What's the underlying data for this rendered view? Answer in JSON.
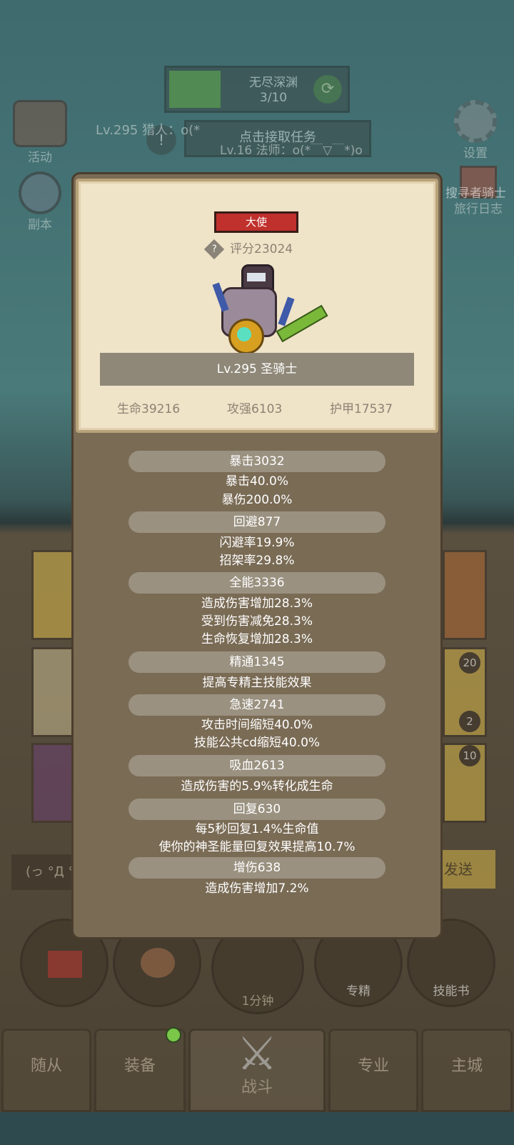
{
  "background": {
    "quest": {
      "title": "无尽深渊",
      "progress": "3/10",
      "accept_label": "点击接取任务"
    },
    "left_menu": [
      {
        "label": "活动"
      },
      {
        "label": "副本"
      }
    ],
    "right_menu": [
      {
        "label": "设置"
      },
      {
        "label": "旅行日志"
      }
    ],
    "party_line_1": "Lv.295 猎人：o(*",
    "party_line_2": "Lv.16 法师：o(*￣▽￣*)o",
    "chat_left": "(っ °Д °",
    "send_label": "发送",
    "timer": "1分钟",
    "round_buttons": [
      {
        "label": "专精"
      },
      {
        "label": "技能书"
      }
    ],
    "badges": [
      "20",
      "2",
      "10"
    ],
    "tabs": [
      {
        "label": "随从"
      },
      {
        "label": "装备"
      },
      {
        "label": "战斗"
      },
      {
        "label": "专业"
      },
      {
        "label": "主城"
      }
    ],
    "right_banner": "搜寻者骑士"
  },
  "popup": {
    "title_badge": "大使",
    "score": "评分23024",
    "character_name": "Lv.295 圣骑士",
    "top_stats": [
      "生命39216",
      "攻强6103",
      "护甲17537"
    ],
    "sections": [
      {
        "header": "暴击3032",
        "lines": [
          "暴击40.0%",
          "暴伤200.0%"
        ]
      },
      {
        "header": "回避877",
        "lines": [
          "闪避率19.9%",
          "招架率29.8%"
        ]
      },
      {
        "header": "全能3336",
        "lines": [
          "造成伤害增加28.3%",
          "受到伤害减免28.3%",
          "生命恢复增加28.3%"
        ]
      },
      {
        "header": "精通1345",
        "lines": [
          "提高专精主技能效果"
        ]
      },
      {
        "header": "急速2741",
        "lines": [
          "攻击时间缩短40.0%",
          "技能公共cd缩短40.0%"
        ]
      },
      {
        "header": "吸血2613",
        "lines": [
          "造成伤害的5.9%转化成生命"
        ]
      },
      {
        "header": "回复630",
        "lines": [
          "每5秒回复1.4%生命值",
          "使你的神圣能量回复效果提高10.7%"
        ]
      },
      {
        "header": "增伤638",
        "lines": [
          "造成伤害增加7.2%"
        ]
      }
    ]
  },
  "colors": {
    "title_badge": "#c0302c",
    "popup_bg": "#7a6b55",
    "card_bg": "#efe3c8"
  }
}
